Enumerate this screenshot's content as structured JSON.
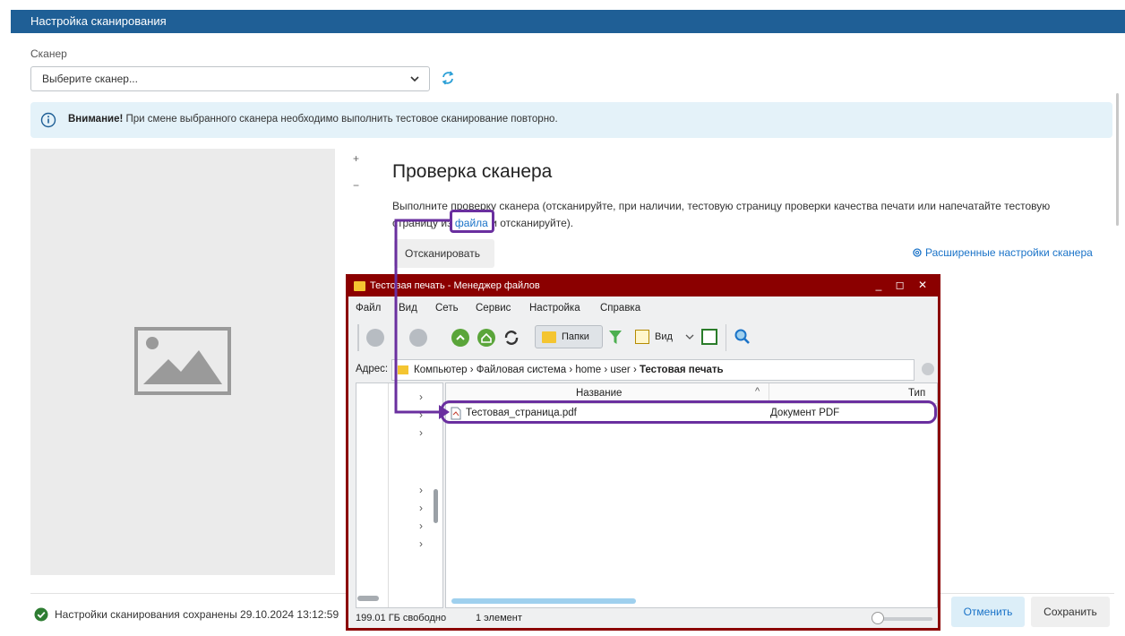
{
  "header": {
    "title": "Настройка сканирования"
  },
  "scanner": {
    "label": "Сканер",
    "selected": "Выберите сканер..."
  },
  "alert": {
    "bold": "Внимание!",
    "text": " При смене выбранного сканера необходимо выполнить тестовое сканирование повторно."
  },
  "zoom": {
    "plus": "+",
    "minus": "−"
  },
  "check": {
    "title": "Проверка сканера",
    "desc_part1": "Выполните проверку сканера (отсканируйте, при наличии, тестовую страницу проверки качества печати или напечатайте тестовую страницу из ",
    "desc_link": "файла",
    "desc_part2": " и отсканируйте).",
    "scan_button": "Отсканировать",
    "advanced_link": "Расширенные настройки сканера"
  },
  "footer": {
    "saved_text": "Настройки сканирования сохранены 29.10.2024 13:12:59",
    "cancel": "Отменить",
    "save": "Сохранить"
  },
  "file_manager": {
    "title": "Тестовая печать - Менеджер файлов",
    "window_controls": "_ ◻ ✕",
    "menu": [
      "Файл",
      "Вид",
      "Сеть",
      "Сервис",
      "Настройка",
      "Справка"
    ],
    "toolbar": {
      "folders": "Папки",
      "view": "Вид"
    },
    "address_label": "Адрес:",
    "path": [
      "Компьютер",
      "Файловая система",
      "home",
      "user"
    ],
    "path_current": "Тестовая печать",
    "columns": {
      "name": "Название",
      "type": "Тип"
    },
    "files": [
      {
        "name": "Тестовая_страница.pdf",
        "type": "Документ PDF"
      }
    ],
    "status": {
      "free": "199.01 ГБ свободно",
      "count": "1 элемент"
    }
  }
}
